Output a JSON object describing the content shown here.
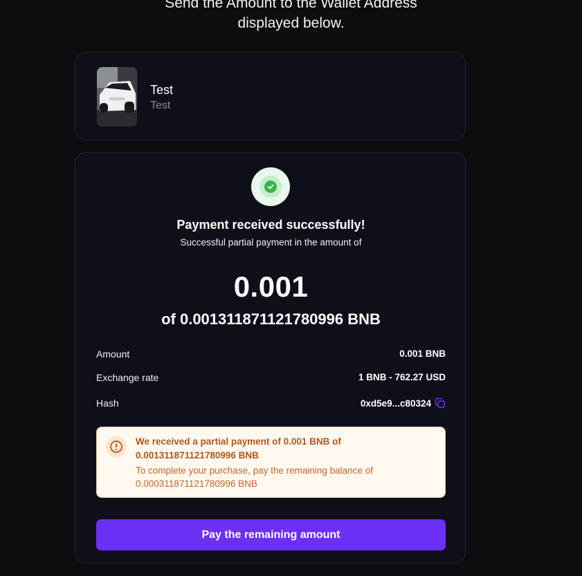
{
  "intro": {
    "line1": "Send the Amount to the Wallet Address",
    "line2": "displayed below."
  },
  "product": {
    "name": "Test",
    "subtitle": "Test",
    "image": "white-sports-car-photo"
  },
  "payment": {
    "status_icon": "check-circle-icon",
    "title": "Payment received successfully!",
    "subtitle": "Successful partial payment in the amount of",
    "amount": "0.001",
    "of_total": "of 0.00131187112178099​6 BNB",
    "details": {
      "amount_label": "Amount",
      "amount_value": "0.001 BNB",
      "rate_label": "Exchange rate",
      "rate_value": "1 BNB - 762.27 USD",
      "hash_label": "Hash",
      "hash_value": "0xd5e9...c80324"
    },
    "warning": {
      "icon": "alert-circle-icon",
      "heading": "We received a partial payment of 0.001 BNB of 0.001311871121780996 BNB",
      "body": "To complete your purchase, pay the remaining balance of 0.000311871121780996 BNB"
    },
    "button_label": "Pay the remaining amount"
  },
  "colors": {
    "background": "#0d0d0f",
    "card": "#0f0f1a",
    "accent": "#6b2ff5",
    "success": "#3ab44a",
    "warning_text": "#b3561b",
    "warning_bg": "#fff9f0"
  }
}
